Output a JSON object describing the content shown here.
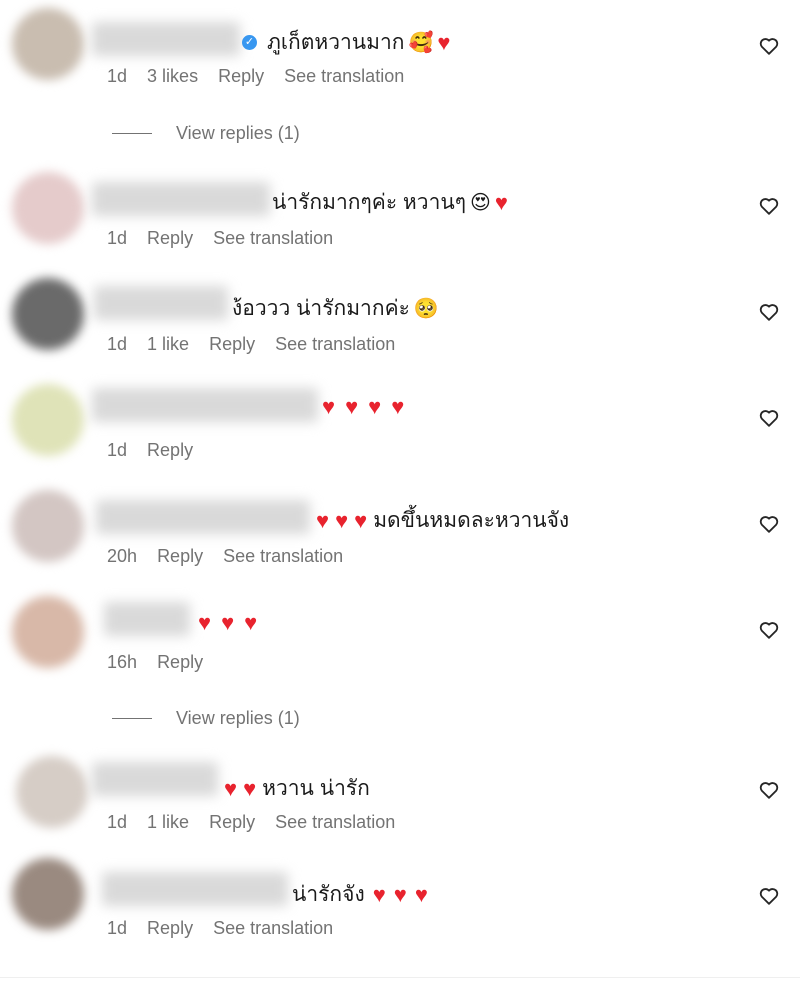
{
  "comments": [
    {
      "text": "ภูเก็ตหวานมาก",
      "time": "1d",
      "likes": "3 likes",
      "reply": "Reply",
      "translate": "See translation",
      "verified": true
    },
    {
      "text": "น่ารักมากๆค่ะ หวานๆ",
      "time": "1d",
      "likes": "",
      "reply": "Reply",
      "translate": "See translation"
    },
    {
      "text": "ง้อววว น่ารักมากค่ะ",
      "time": "1d",
      "likes": "1 like",
      "reply": "Reply",
      "translate": "See translation"
    },
    {
      "text": "",
      "time": "1d",
      "likes": "",
      "reply": "Reply",
      "translate": ""
    },
    {
      "text": "มดขึ้นหมดละหวานจัง",
      "time": "20h",
      "likes": "",
      "reply": "Reply",
      "translate": "See translation"
    },
    {
      "text": "",
      "time": "16h",
      "likes": "",
      "reply": "Reply",
      "translate": ""
    },
    {
      "text": "หวาน น่ารัก",
      "time": "1d",
      "likes": "1 like",
      "reply": "Reply",
      "translate": "See translation"
    },
    {
      "text": "น่ารักจัง",
      "time": "1d",
      "likes": "",
      "reply": "Reply",
      "translate": "See translation"
    }
  ],
  "view_replies": [
    "View replies (1)",
    "View replies (1)"
  ],
  "icons": {
    "heart": "heart-outline-icon",
    "verified": "verified-badge-icon",
    "heart_emoji": "red-heart-emoji"
  },
  "colors": {
    "meta": "#737373",
    "heart": "#e8232e",
    "verified": "#3897f0"
  }
}
